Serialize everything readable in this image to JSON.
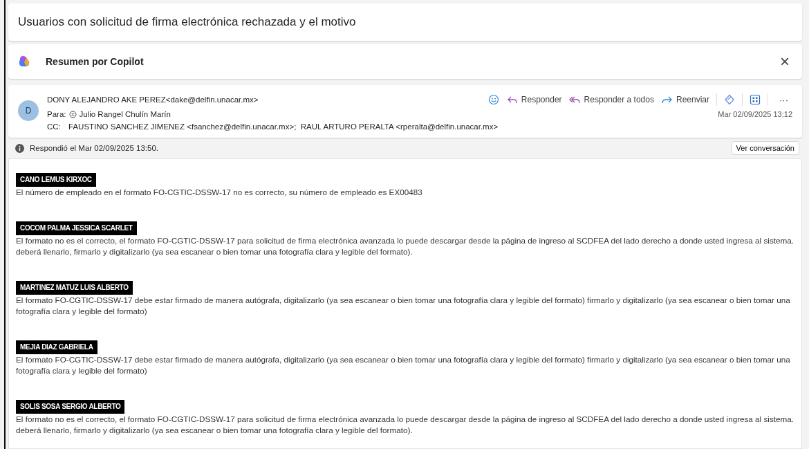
{
  "title": "Usuarios con solicitud de firma electrónica rechazada y el motivo",
  "copilot": {
    "label": "Resumen por Copilot",
    "close": "×"
  },
  "email": {
    "avatar": "D",
    "from": "DONY ALEJANDRO AKE PEREZ<dake@delfin.unacar.mx>",
    "to_label": "Para:",
    "to": "Julio Rangel Chulín Marín",
    "cc_label": "CC:",
    "cc": "FAUSTINO SANCHEZ JIMENEZ <fsanchez@delfin.unacar.mx>;  RAUL ARTURO PERALTA <rperalta@delfin.unacar.mx>",
    "date": "Mar 02/09/2025 13:12",
    "actions": [
      {
        "kind": "reply",
        "label": "Responder"
      },
      {
        "kind": "reply_all",
        "label": "Responder a todos"
      },
      {
        "kind": "forward",
        "label": "Reenviar"
      }
    ],
    "more": "···"
  },
  "info": {
    "text": "Respondió el Mar 02/09/2025 13:50.",
    "button": "Ver conversación"
  },
  "entries": [
    {
      "name": "CANO LEMUS KIRXOC",
      "reason": "El número de empleado en el formato FO-CGTIC-DSSW-17 no es correcto, su número de empleado es EX00483"
    },
    {
      "name": "COCOM PALMA JESSICA SCARLET",
      "reason": "El formato no es el correcto, el formato FO-CGTIC-DSSW-17 para solicitud de firma electrónica avanzada lo puede descargar desde la página de ingreso al SCDFEA del lado derecho a donde usted ingresa al sistema. deberá llenarlo, firmarlo y digitalizarlo (ya sea escanear o bien tomar una fotografía clara y legible del formato)."
    },
    {
      "name": "MARTINEZ MATUZ LUIS ALBERTO",
      "reason": "El formato FO-CGTIC-DSSW-17 debe estar firmado de manera autógrafa, digitalizarlo (ya sea escanear o bien tomar una fotografía clara y legible del formato) firmarlo y digitalizarlo (ya sea escanear o bien tomar una fotografía clara y legible del formato)"
    },
    {
      "name": "MEJIA DIAZ GABRIELA",
      "reason": "El formato FO-CGTIC-DSSW-17 debe estar firmado de manera autógrafa, digitalizarlo (ya sea escanear o bien tomar una fotografía clara y legible del formato) firmarlo y digitalizarlo (ya sea escanear o bien tomar una fotografía clara y legible del formato)"
    },
    {
      "name": "SOLIS SOSA SERGIO ALBERTO",
      "reason": "El formato no es el correcto, el formato FO-CGTIC-DSSW-17 para solicitud de firma electrónica avanzada lo puede descargar desde la página de ingreso al SCDFEA del lado derecho a donde usted ingresa al sistema. deberá llenarlo, firmarlo y digitalizarlo (ya sea escanear o bien tomar una fotografía clara y legible del formato)."
    }
  ]
}
